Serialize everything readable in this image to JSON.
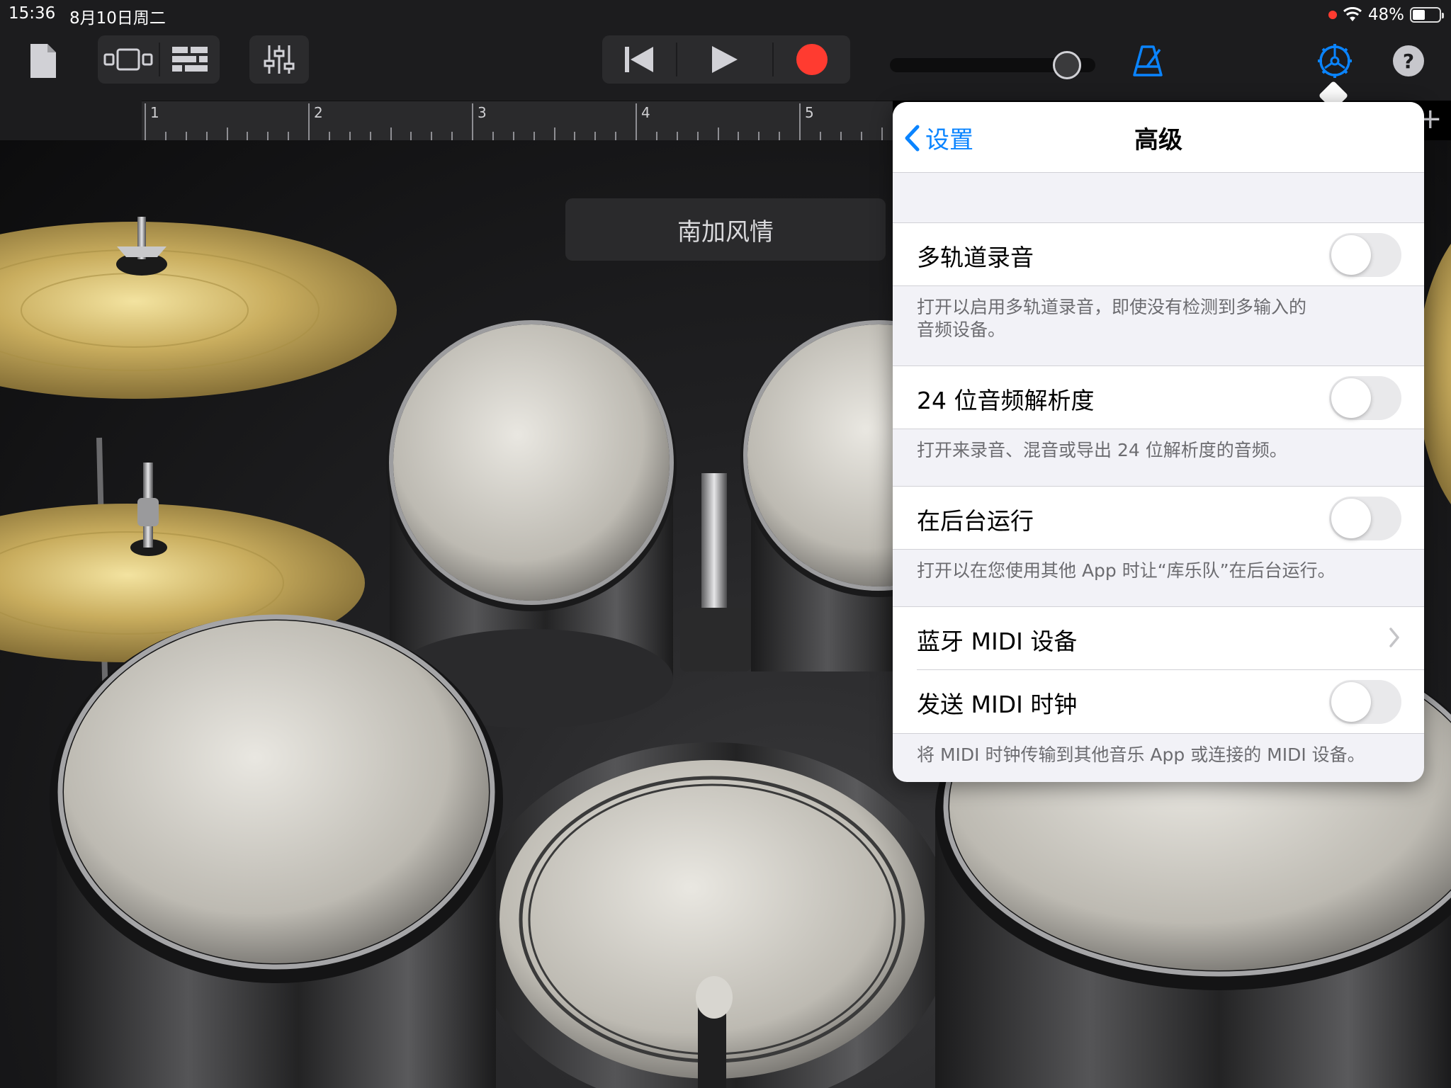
{
  "status_bar": {
    "time": "15:36",
    "date": "8月10日周二",
    "battery_percent": "48%",
    "battery_level": 0.48,
    "recording_indicator_color": "#ff3b30"
  },
  "toolbar": {
    "icons": {
      "my_songs": "document-icon",
      "view_switch": "instrument-view-icon",
      "tracks_view": "tracks-view-icon",
      "mixer": "mixer-sliders-icon",
      "rewind": "go-to-beginning-icon",
      "play": "play-icon",
      "record": "record-icon",
      "master_volume_level": 0.92,
      "metronome": "metronome-icon",
      "settings": "gear-icon",
      "help": "help-icon"
    },
    "help_label": "?",
    "accent_color": "#0a84ff",
    "record_color": "#ff3b30"
  },
  "ruler": {
    "bars": [
      "1",
      "2",
      "3",
      "4",
      "5"
    ],
    "add_label": "+"
  },
  "stage": {
    "preset_name": "南加风情"
  },
  "popover": {
    "back_label": "设置",
    "title": "高级",
    "settings": [
      {
        "label": "多轨道录音",
        "type": "toggle",
        "on": false,
        "footnote": [
          "打开以启用多轨道录音，即使没有检测到多输入的",
          "音频设备。"
        ]
      },
      {
        "label": "24 位音频解析度",
        "type": "toggle",
        "on": false,
        "footnote": [
          "打开来录音、混音或导出 24 位解析度的音频。"
        ]
      },
      {
        "label": "在后台运行",
        "type": "toggle",
        "on": false,
        "footnote": [
          "打开以在您使用其他 App 时让“库乐队”在后台运行。"
        ]
      },
      {
        "label": "蓝牙 MIDI 设备",
        "type": "disclosure"
      },
      {
        "label": "发送 MIDI 时钟",
        "type": "toggle",
        "on": false,
        "footnote": [
          "将 MIDI 时钟传输到其他音乐 App 或连接的 MIDI 设备。"
        ]
      }
    ]
  }
}
